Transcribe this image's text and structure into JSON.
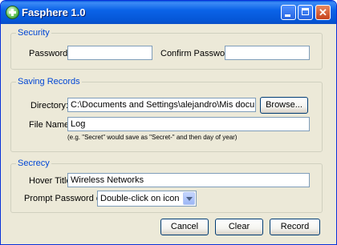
{
  "window": {
    "title": "Fasphere 1.0",
    "close_symbol": "✕"
  },
  "security": {
    "legend": "Security",
    "password_label": "Password:",
    "password_value": "",
    "confirm_label": "Confirm Password:",
    "confirm_value": ""
  },
  "saving": {
    "legend": "Saving Records",
    "directory_label": "Directory:",
    "directory_value": "C:\\Documents and Settings\\alejandro\\Mis documentos\\Fa",
    "browse_label": "Browse...",
    "filename_label": "File Name:",
    "filename_value": "Log",
    "hint": "(e.g. \"Secret\" would save as \"Secret-\" and then day of year)"
  },
  "secrecy": {
    "legend": "Secrecy",
    "hover_label": "Hover Title:",
    "hover_value": "Wireless Networks",
    "prompt_label": "Prompt Password on:",
    "prompt_value": "Double-click on icon"
  },
  "buttons": {
    "cancel": "Cancel",
    "clear": "Clear",
    "record": "Record"
  },
  "icons": {
    "app": "app-plus-icon",
    "minimize": "minimize-icon",
    "maximize": "maximize-icon",
    "close": "close-icon",
    "dropdown": "chevron-down-icon"
  }
}
